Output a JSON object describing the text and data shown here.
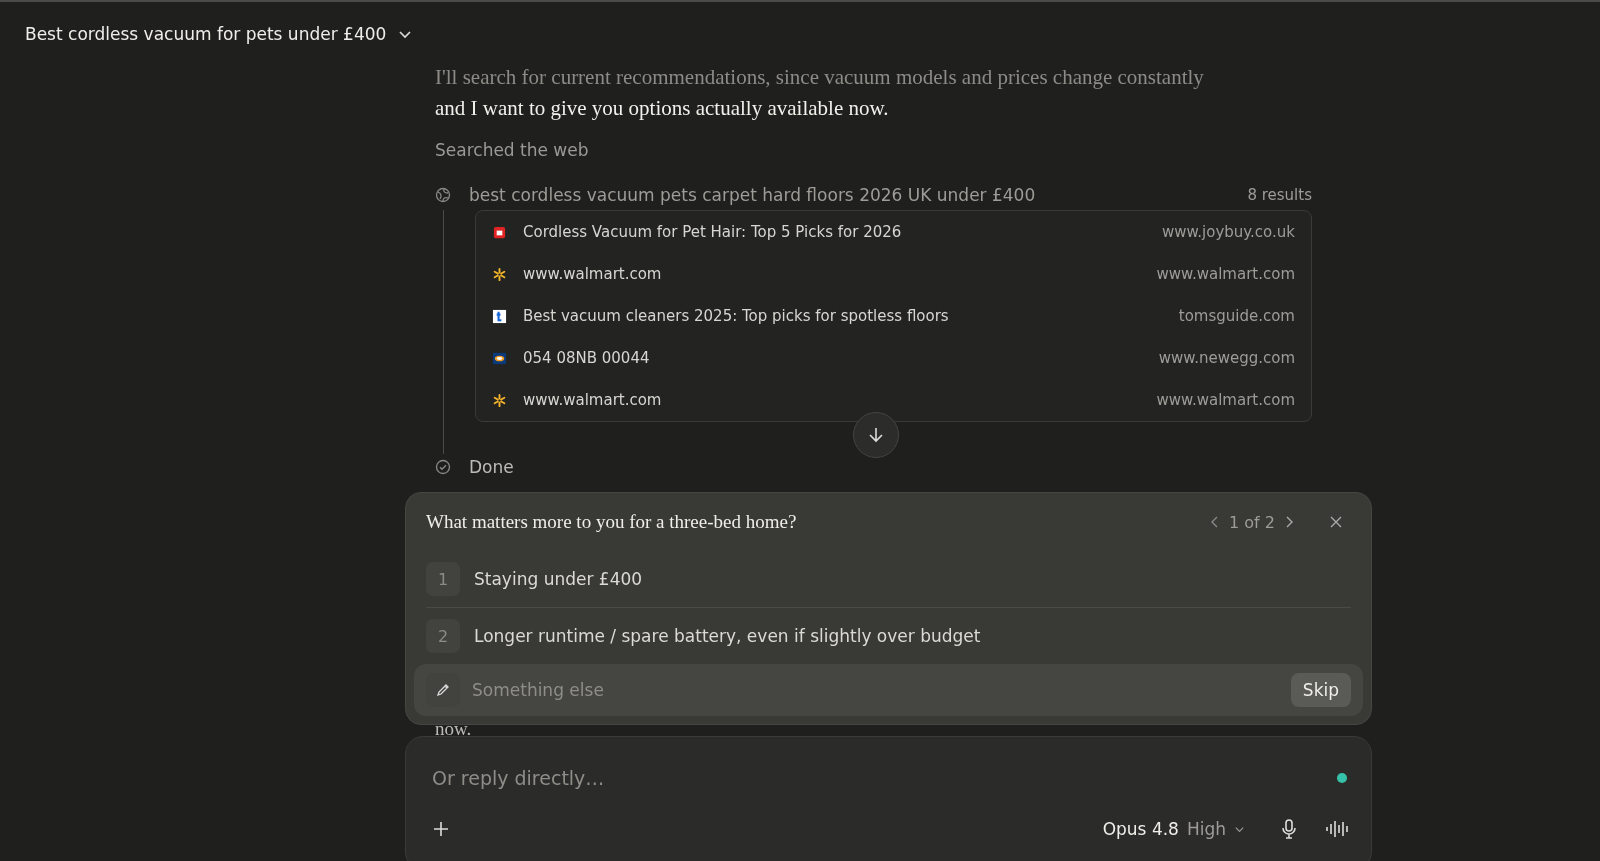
{
  "header": {
    "title": "Best cordless vacuum for pets under £400"
  },
  "message": {
    "lines": [
      {
        "text": "I'll search for current recommendations, since vacuum models and prices change constantly",
        "faded": true
      },
      {
        "text": "and I want to give you options actually available now.",
        "faded": false
      }
    ]
  },
  "search_activity": {
    "label": "Searched the web",
    "query": "best cordless vacuum pets carpet hard floors 2026 UK under £400",
    "result_count": "8 results",
    "results": [
      {
        "title": "Cordless Vacuum for Pet Hair: Top 5 Picks for 2026",
        "domain": "www.joybuy.co.uk",
        "kind": "joybuy"
      },
      {
        "title": "www.walmart.com",
        "domain": "www.walmart.com",
        "kind": "walmart"
      },
      {
        "title": "Best vacuum cleaners 2025: Top picks for spotless floors",
        "domain": "tomsguide.com",
        "kind": "tomsguide"
      },
      {
        "title": "054 08NB 00044",
        "domain": "www.newegg.com",
        "kind": "newegg"
      },
      {
        "title": "www.walmart.com",
        "domain": "www.walmart.com",
        "kind": "walmart"
      }
    ],
    "done_label": "Done"
  },
  "question": {
    "text": "What matters more to you for a three-bed home?",
    "pager": "1 of 2",
    "options": [
      {
        "number": "1",
        "label": "Staying under £400"
      },
      {
        "number": "2",
        "label": "Longer runtime / spare battery, even if slightly over budget"
      }
    ],
    "other_placeholder": "Something else",
    "skip_label": "Skip"
  },
  "trailing_text": "now.",
  "composer": {
    "placeholder": "Or reply directly…",
    "model": "Opus 4.8",
    "effort": "High"
  }
}
